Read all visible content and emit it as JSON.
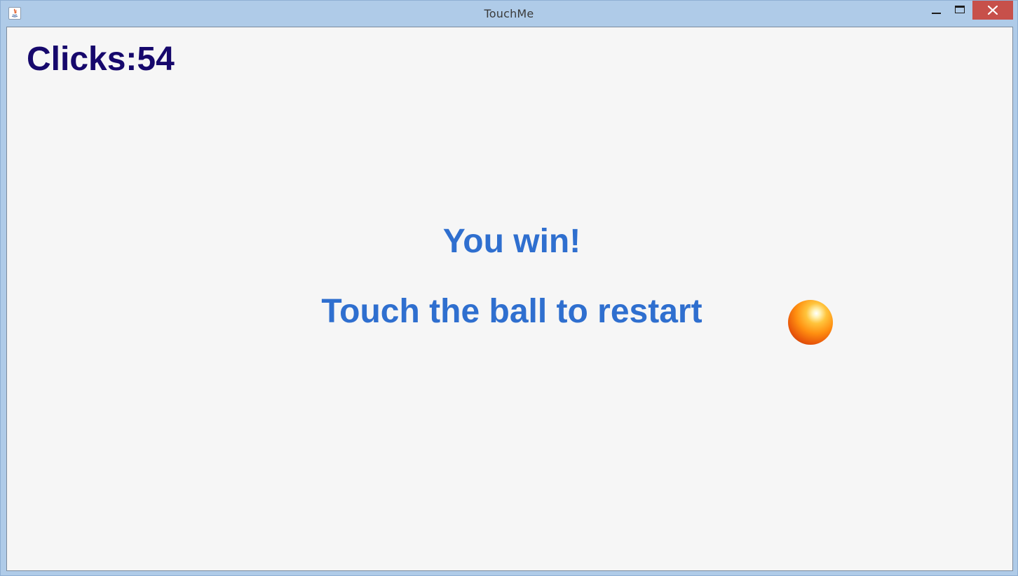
{
  "window": {
    "title": "TouchMe",
    "icon": "java-icon",
    "controls": {
      "minimize": "minimize-icon",
      "maximize": "maximize-icon",
      "close": "close-icon"
    }
  },
  "game": {
    "clicks_text": "Clicks:54",
    "win_message": "You win!",
    "restart_message": "Touch the ball to restart",
    "colors": {
      "clicks": "#16086c",
      "message": "#2f6fcf",
      "ball": "#ff8f10",
      "background": "#f6f6f6",
      "close_button": "#c7504a"
    }
  }
}
